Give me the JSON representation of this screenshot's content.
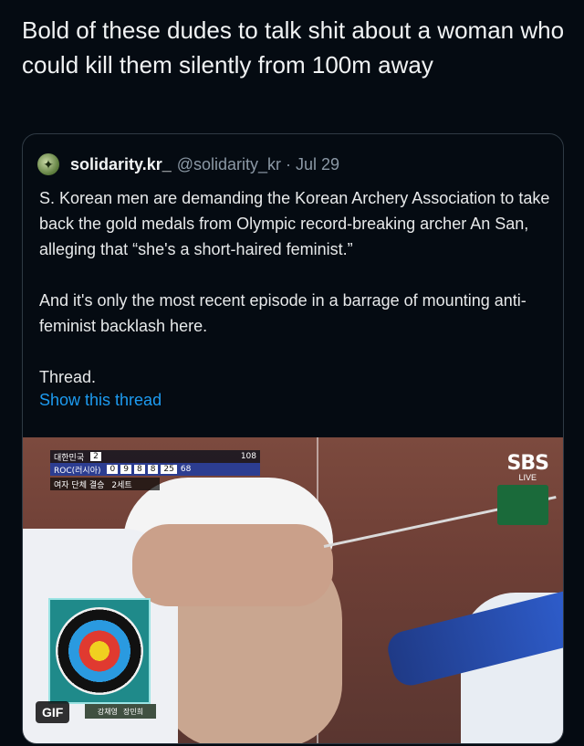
{
  "tweet": {
    "text": "Bold of these dudes to talk shit about a woman who could kill them silently from 100m away"
  },
  "quoted": {
    "name": "solidarity.kr_",
    "handle": "@solidarity_kr",
    "separator": "·",
    "date": "Jul 29",
    "paragraphs": [
      "S. Korean men are demanding the Korean Archery Association to take back the gold medals from Olympic record-breaking archer An San, alleging that “she's a short-haired feminist.”",
      "And it's only the most recent episode in a barrage of mounting anti-feminist backlash here.",
      "Thread."
    ],
    "show_thread": "Show this thread"
  },
  "media": {
    "badge": "GIF",
    "broadcaster": "SBS",
    "live": "LIVE",
    "scoreboard": {
      "team1": "대한민국",
      "team1_score": "2",
      "team1_total": "108",
      "team2": "ROC(러시아)",
      "team2_ends": [
        "0",
        "9",
        "8",
        "8",
        "25"
      ],
      "team2_total": "68",
      "event": "여자 단체 결승",
      "set": "2세트"
    },
    "target_label": [
      "강채영",
      "장민희"
    ]
  },
  "colors": {
    "background": "#050b12",
    "link": "#1d9bf0",
    "border": "#2f3a44"
  }
}
